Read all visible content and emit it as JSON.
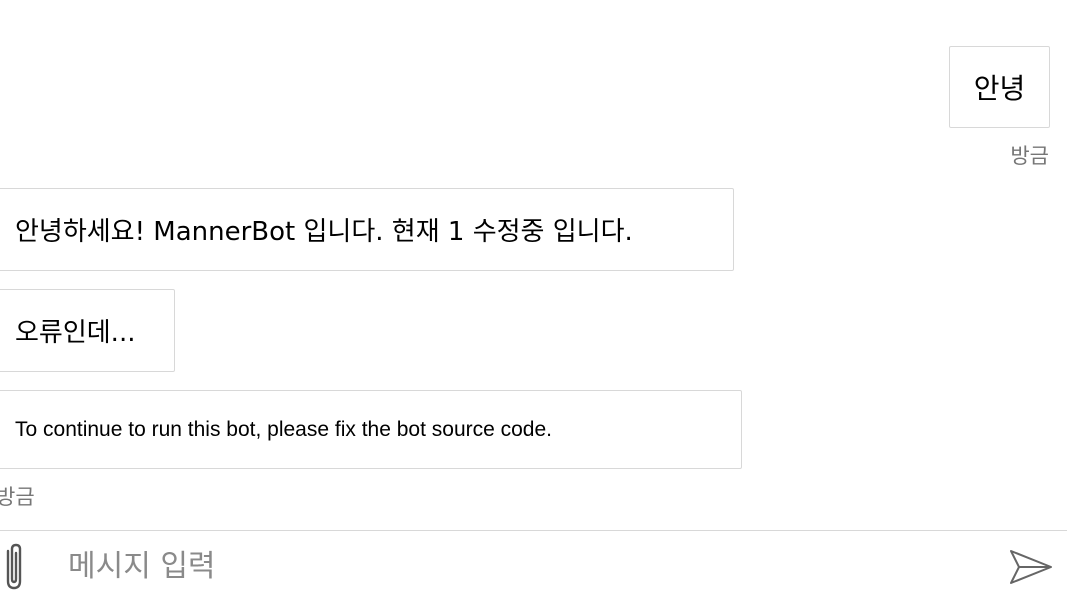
{
  "messages": {
    "user": [
      {
        "text": "안녕",
        "time": "방금"
      }
    ],
    "bot": [
      {
        "text": "안녕하세요! MannerBot 입니다. 현재 1 수정중 입니다."
      },
      {
        "text": "오류인데..."
      },
      {
        "text": "To continue to run this bot, please fix the bot source code."
      }
    ],
    "bot_time": "방금"
  },
  "input": {
    "placeholder": "메시지 입력",
    "value": ""
  },
  "icons": {
    "attach": "paperclip-icon",
    "send": "send-icon"
  },
  "colors": {
    "bubble_border": "#d8d8d8",
    "timestamp": "#767676",
    "placeholder": "#8a8a8a"
  }
}
